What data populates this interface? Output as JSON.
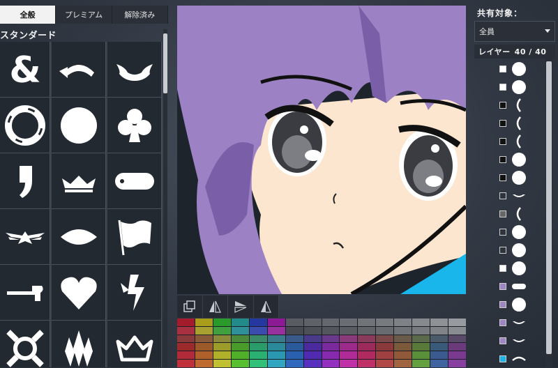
{
  "tabs": [
    {
      "label": "全般",
      "active": true
    },
    {
      "label": "プレミアム",
      "active": false
    },
    {
      "label": "解除済み",
      "active": false
    }
  ],
  "library": {
    "section_title": "スタンダード",
    "shapes": [
      {
        "icon": "ampersand-icon"
      },
      {
        "icon": "arc-arrow-icon"
      },
      {
        "icon": "ribbon-banner-icon"
      },
      {
        "icon": "lifebuoy-icon"
      },
      {
        "icon": "circle-icon"
      },
      {
        "icon": "club-icon"
      },
      {
        "icon": "comma-icon"
      },
      {
        "icon": "crown-icon"
      },
      {
        "icon": "dog-tag-icon"
      },
      {
        "icon": "winged-eagle-icon"
      },
      {
        "icon": "lens-shape-icon"
      },
      {
        "icon": "flag-icon"
      },
      {
        "icon": "hammer-icon"
      },
      {
        "icon": "heart-icon"
      },
      {
        "icon": "lightning-bolt-icon"
      },
      {
        "icon": "ornate-x-icon"
      },
      {
        "icon": "flame-crest-icon"
      },
      {
        "icon": "crown-outline-icon"
      }
    ]
  },
  "tools": [
    {
      "icon": "duplicate-icon"
    },
    {
      "icon": "flip-horizontal-icon"
    },
    {
      "icon": "flip-vertical-icon"
    },
    {
      "icon": "mirror-icon"
    }
  ],
  "palette_rows": [
    [
      "#a41c2b",
      "#a89c1a",
      "#2a9a2a",
      "#238a8a",
      "#2438a0",
      "#8c1a94",
      "#585c62",
      "#5e6268",
      "#64686e",
      "#6a6e74",
      "#707478",
      "#777b80",
      "#7e8287",
      "#868a8e",
      "#8e9296",
      "#979a9e"
    ],
    [
      "#a83040",
      "#a8a030",
      "#40a040",
      "#30909a",
      "#3a4cae",
      "#98309e",
      "#474b51",
      "#4d5157",
      "#53575d",
      "#5a5e63",
      "#61656a",
      "#686c71",
      "#707479",
      "#787c81",
      "#808489",
      "#898d91"
    ],
    [
      "#8a3a3a",
      "#8a5a3a",
      "#8a8a3a",
      "#4a8a3a",
      "#3a8a6a",
      "#3a7a8a",
      "#3a5a8a",
      "#4a3a8a",
      "#6a3a8a",
      "#8a3a7a",
      "#8a3a5a",
      "#7a4a4a",
      "#6a5a4a",
      "#5a6a4a",
      "#4a5a6a",
      "#5a4a6a"
    ],
    [
      "#9c2a2a",
      "#9c5a2a",
      "#9c9c2a",
      "#4a9c2a",
      "#2a9c6a",
      "#2a8a9c",
      "#2a5a9c",
      "#4a2a9c",
      "#7a2a9c",
      "#9c2a8a",
      "#9c2a5a",
      "#8a3a3a",
      "#7a5a3a",
      "#5a7a3a",
      "#3a5a7a",
      "#6a3a7a"
    ],
    [
      "#b02a3a",
      "#b0602a",
      "#b0b02a",
      "#50b02a",
      "#2ab070",
      "#2a98b0",
      "#2a60b0",
      "#502ab0",
      "#882ab0",
      "#b02a98",
      "#b02a60",
      "#a04040",
      "#905a3a",
      "#5a903a",
      "#3a5a90",
      "#7a3a90"
    ],
    [
      "#c0303a",
      "#c06a30",
      "#c0c030",
      "#58c030",
      "#30c078",
      "#30a6c0",
      "#3068c0",
      "#5830c0",
      "#9430c0",
      "#c030a6",
      "#c03068",
      "#b04848",
      "#a06440",
      "#64a040",
      "#4064a0",
      "#8840a0"
    ]
  ],
  "share": {
    "title": "共有対象：",
    "selected": "全員"
  },
  "layers": {
    "label": "レイヤー",
    "count": "40 / 40",
    "items": [
      {
        "chip": "#ffffff",
        "shape": "circle"
      },
      {
        "chip": "#ffffff",
        "shape": "circle"
      },
      {
        "chip": "#111111",
        "shape": "paren"
      },
      {
        "chip": "#111111",
        "shape": "paren"
      },
      {
        "chip": "#111111",
        "shape": "paren"
      },
      {
        "chip": "#111111",
        "shape": "circle"
      },
      {
        "chip": "#111111",
        "shape": "circle"
      },
      {
        "chip": "#2f343c",
        "shape": "smile"
      },
      {
        "chip": "#666666",
        "shape": "paren"
      },
      {
        "chip": "#2f343c",
        "shape": "circle"
      },
      {
        "chip": "#2f343c",
        "shape": "circle"
      },
      {
        "chip": "#ffffff",
        "shape": "circle"
      },
      {
        "chip": "#9e85c4",
        "shape": "tag"
      },
      {
        "chip": "#9e85c4",
        "shape": "circle"
      },
      {
        "chip": "#9e85c4",
        "shape": "smile"
      },
      {
        "chip": "#9e85c4",
        "shape": "smile"
      },
      {
        "chip": "#1fb4e8",
        "shape": "arc"
      }
    ]
  },
  "colors": {
    "hair": "#9c82c4",
    "hair_shadow": "#7a5fa8",
    "skin": "#fde6d0",
    "eye": "#3a3c42",
    "shirt": "#18b6ea"
  }
}
